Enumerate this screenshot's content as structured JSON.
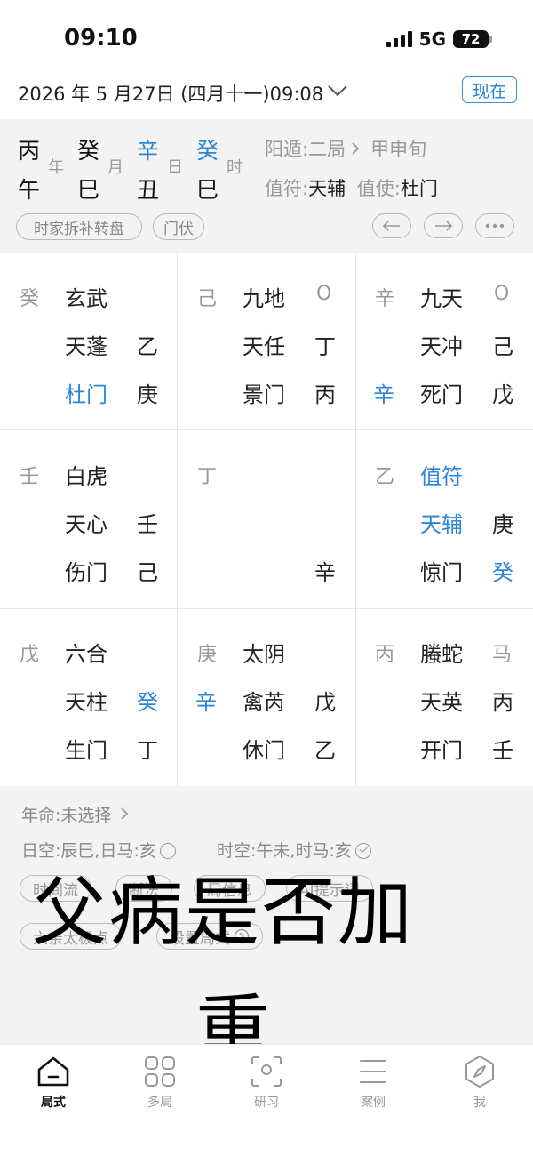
{
  "status": {
    "time": "09:10",
    "network": "5G",
    "battery": "72"
  },
  "header": {
    "datetime": "2026 年 5 月27日 (四月十一)09:08",
    "now_button": "现在"
  },
  "pillars": [
    {
      "stem": "丙",
      "branch": "午",
      "label": "年"
    },
    {
      "stem": "癸",
      "branch": "巳",
      "label": "月"
    },
    {
      "stem": "辛",
      "branch": "丑",
      "label": "日"
    },
    {
      "stem": "癸",
      "branch": "巳",
      "label": "时"
    }
  ],
  "ju": {
    "dun": "阳遁:二局",
    "xun": "甲申旬",
    "zhifu_label": "值符:",
    "zhifu": "天辅",
    "zhishi_label": "值使:",
    "zhishi": "杜门"
  },
  "chips": {
    "method": "时家拆补转盘",
    "menfu": "门伏"
  },
  "palaces": [
    {
      "left": "癸",
      "god": "玄武",
      "r1": "",
      "star": "天蓬",
      "r2": "乙",
      "midleft": "",
      "door": "杜门",
      "r3": "庚"
    },
    {
      "left": "己",
      "god": "九地",
      "r1": "O",
      "star": "天任",
      "r2": "丁",
      "midleft": "",
      "door": "景门",
      "r3": "丙"
    },
    {
      "left": "辛",
      "god": "九天",
      "r1": "O",
      "star": "天冲",
      "r2": "己",
      "midleft": "辛",
      "door": "死门",
      "r3": "戊"
    },
    {
      "left": "壬",
      "god": "白虎",
      "r1": "",
      "star": "天心",
      "r2": "壬",
      "midleft": "",
      "door": "伤门",
      "r3": "己"
    },
    {
      "left": "丁",
      "god": "",
      "r1": "",
      "star": "",
      "r2": "",
      "midleft": "",
      "door": "",
      "r3": "辛"
    },
    {
      "left": "乙",
      "god": "值符",
      "r1": "",
      "star": "天辅",
      "r2": "庚",
      "midleft": "",
      "door": "惊门",
      "r3": "癸"
    },
    {
      "left": "戊",
      "god": "六合",
      "r1": "",
      "star": "天柱",
      "r2": "癸",
      "midleft": "",
      "door": "生门",
      "r3": "丁"
    },
    {
      "left": "庚",
      "god": "太阴",
      "r1": "",
      "star": "禽芮",
      "r2": "戊",
      "midleft": "辛",
      "door": "休门",
      "r3": "乙"
    },
    {
      "left": "丙",
      "god": "螣蛇",
      "r1": "马",
      "star": "天英",
      "r2": "丙",
      "midleft": "",
      "door": "开门",
      "r3": "壬"
    }
  ],
  "info": {
    "nianming": "年命:未选择",
    "rikong": "日空:辰巳,日马:亥",
    "shikong": "时空:午未,时马:亥",
    "pills": [
      "时间流",
      "断法",
      "局信息",
      "AI提示词",
      "六亲太极点",
      "设置局式"
    ]
  },
  "overlay": {
    "line1": "父病是否加",
    "line2": "重"
  },
  "tabs": [
    {
      "label": "局式",
      "icon": "home-icon"
    },
    {
      "label": "多局",
      "icon": "grid-icon"
    },
    {
      "label": "研习",
      "icon": "scan-icon"
    },
    {
      "label": "案例",
      "icon": "list-icon"
    },
    {
      "label": "我",
      "icon": "compass-icon"
    }
  ],
  "colors": {
    "accent": "#2b86d9",
    "muted": "#999999",
    "panel": "#f3f3f3"
  }
}
